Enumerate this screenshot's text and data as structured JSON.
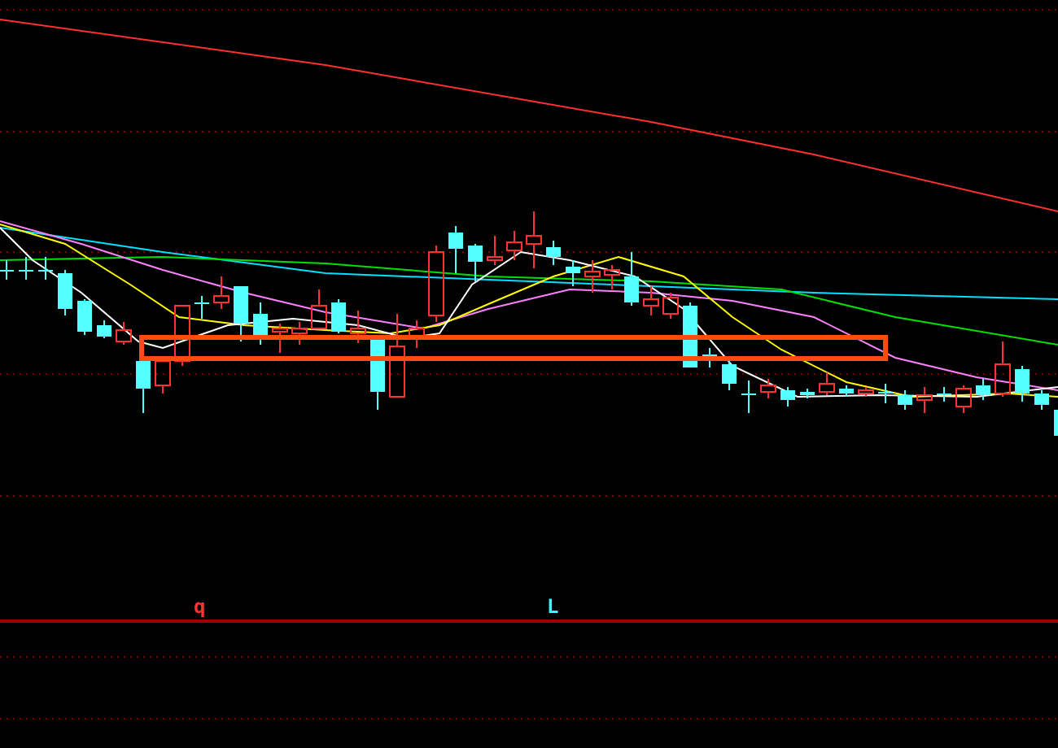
{
  "markers": [
    {
      "label": "q",
      "color": "#ff3333"
    },
    {
      "label": "L",
      "color": "#33ffff"
    }
  ]
}
